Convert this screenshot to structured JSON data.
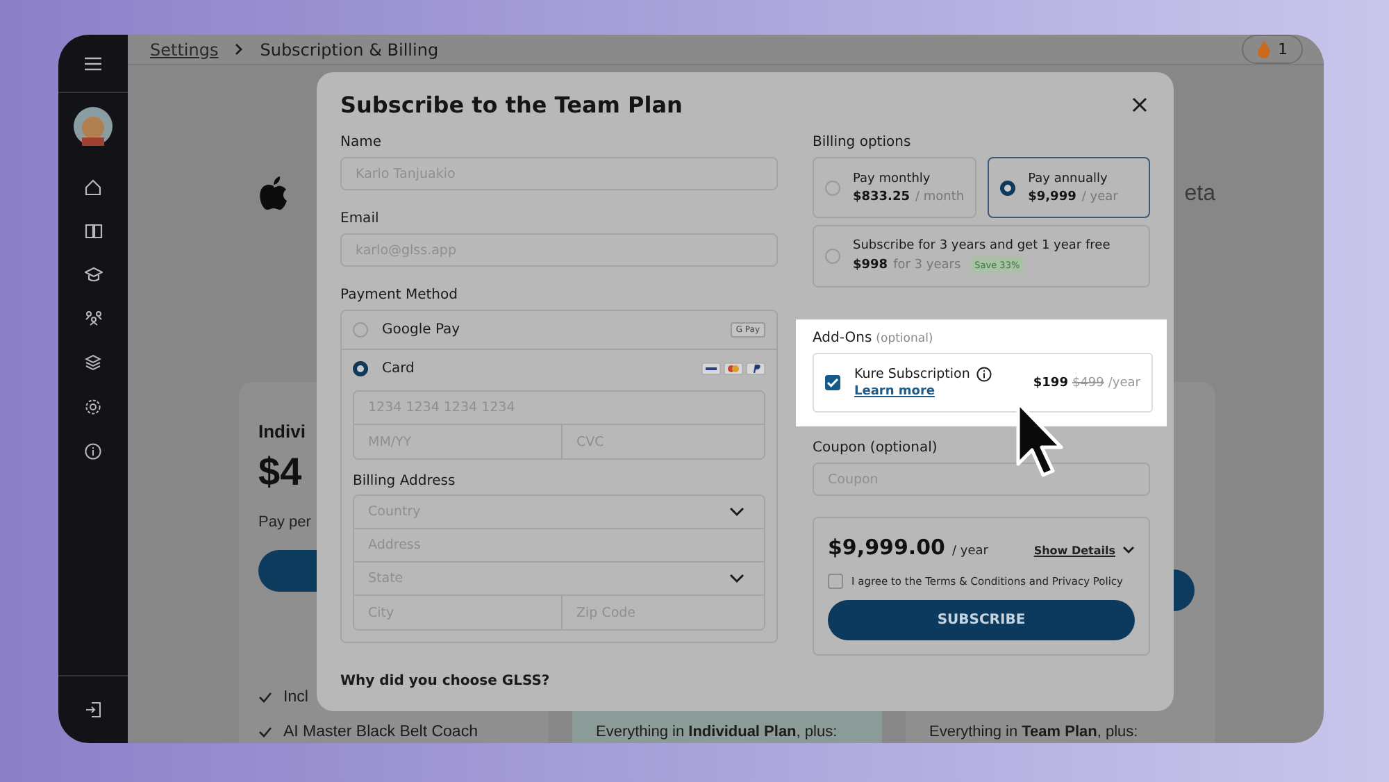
{
  "header": {
    "breadcrumb": [
      {
        "label": "Settings",
        "link": true
      },
      {
        "label": "Subscription & Billing",
        "link": false
      }
    ],
    "streak_count": "1"
  },
  "background": {
    "logo_text": "eta",
    "cards": [
      {
        "title": "Indivi",
        "price": "$4",
        "note": "Pay per",
        "features": [
          "Incl",
          "AI Master Black Belt Coach"
        ]
      }
    ],
    "plan_blurbs": [
      "Everything in **Individual Plan**, plus:",
      "Everything in **Team Plan**, plus:"
    ]
  },
  "modal": {
    "title": "Subscribe to the Team Plan",
    "fields": [
      {
        "label": "Name",
        "placeholder": "Karlo Tanjuakio"
      },
      {
        "label": "Email",
        "placeholder": "karlo@glss.app"
      }
    ],
    "payment": {
      "label": "Payment Method",
      "options": [
        {
          "label": "Google Pay",
          "badge": "G Pay",
          "selected": false
        },
        {
          "label": "Card",
          "selected": true
        }
      ],
      "card_fields": [
        {
          "placeholder": "1234 1234 1234 1234",
          "kind": "text"
        },
        {
          "placeholder": "MM/YY",
          "kind": "half"
        },
        {
          "placeholder": "CVC",
          "kind": "half"
        }
      ],
      "address_label": "Billing Address",
      "address_fields": [
        {
          "placeholder": "Country",
          "kind": "select"
        },
        {
          "placeholder": "Address",
          "kind": "text"
        },
        {
          "placeholder": "State",
          "kind": "select"
        },
        {
          "placeholder": "City",
          "kind": "half"
        },
        {
          "placeholder": "Zip Code",
          "kind": "half"
        }
      ]
    },
    "question": "Why did you choose GLSS?",
    "billing": {
      "label": "Billing options",
      "options": [
        {
          "title": "Pay monthly",
          "price": "$833.25",
          "period": "/ month",
          "selected": false
        },
        {
          "title": "Pay annually",
          "price": "$9,999",
          "period": "/ year",
          "selected": true
        },
        {
          "title": "Subscribe for 3 years and get 1 year free",
          "price": "$998",
          "period": "for 3 years",
          "badge": "Save 33%",
          "selected": false
        }
      ]
    },
    "addons": {
      "label": "Add-Ons",
      "hint": "(optional)",
      "spotlight": true,
      "items": [
        {
          "name": "Kure Subscription",
          "link": "Learn more",
          "price": "$199",
          "old_price": "$499",
          "period": "/year",
          "checked": true
        }
      ]
    },
    "coupon": {
      "label": "Coupon (optional)",
      "placeholder": "Coupon"
    },
    "summary": {
      "total": "$9,999.00",
      "period": "/ year",
      "details_link": "Show Details",
      "agree": {
        "label": "I agree to the Terms & Conditions and Privacy Policy",
        "checked": false
      },
      "button": "SUBSCRIBE"
    }
  }
}
